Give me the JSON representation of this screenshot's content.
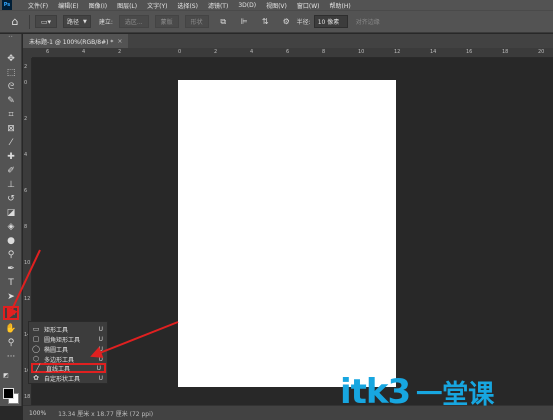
{
  "app": {
    "logo_text": "Ps"
  },
  "menu": [
    "文件(F)",
    "编辑(E)",
    "图像(I)",
    "图层(L)",
    "文字(Y)",
    "选择(S)",
    "滤镜(T)",
    "3D(D)",
    "视图(V)",
    "窗口(W)",
    "帮助(H)"
  ],
  "options": {
    "mode_value": "路径",
    "create_label": "建立:",
    "selection_btn": "选区...",
    "mask_btn": "蒙版",
    "shape_btn": "形状",
    "radius_label": "半径:",
    "radius_value": "10 像素",
    "align_edges": "对齐边缘"
  },
  "document": {
    "tab_title": "未标题-1 @ 100%(RGB/8#) *",
    "close": "×",
    "canvas_color": "#ffffff"
  },
  "ruler_top": [
    "6",
    "4",
    "2",
    "0",
    "2",
    "4",
    "6",
    "8",
    "10",
    "12",
    "14",
    "16",
    "18",
    "20"
  ],
  "ruler_left": [
    "2",
    "0",
    "2",
    "4",
    "6",
    "8",
    "10",
    "12",
    "14",
    "16",
    "18"
  ],
  "flyout": {
    "items": [
      {
        "label": "矩形工具",
        "key": "U",
        "icon": "rectangle-icon"
      },
      {
        "label": "圆角矩形工具",
        "key": "U",
        "icon": "rounded-rectangle-icon"
      },
      {
        "label": "椭圆工具",
        "key": "U",
        "icon": "ellipse-icon"
      },
      {
        "label": "多边形工具",
        "key": "U",
        "icon": "polygon-icon"
      },
      {
        "label": "直线工具",
        "key": "U",
        "icon": "line-icon"
      },
      {
        "label": "自定形状工具",
        "key": "U",
        "icon": "custom-shape-icon"
      }
    ],
    "highlighted": "直线工具"
  },
  "status": {
    "zoom": "100%",
    "dimensions": "13.34 厘米 x 18.77 厘米 (72 ppi)"
  },
  "watermark": {
    "latin": "itk3",
    "cjk": "一堂课"
  },
  "colors": {
    "accent_red": "#e02020",
    "watermark_blue": "#17a6e0"
  }
}
